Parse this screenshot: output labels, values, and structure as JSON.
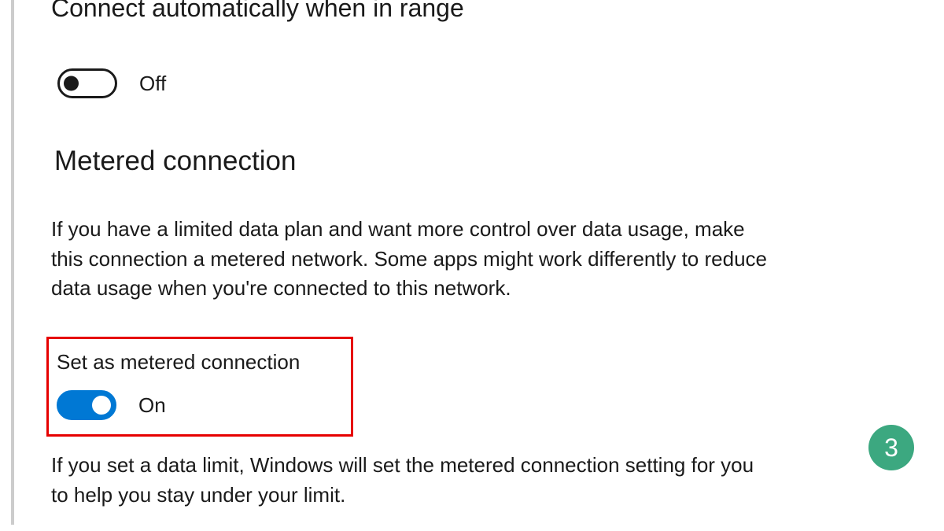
{
  "autoConnect": {
    "heading": "Connect automatically when in range",
    "state": "off",
    "label": "Off"
  },
  "metered": {
    "heading": "Metered connection",
    "description": "If you have a limited data plan and want more control over data usage, make this connection a metered network. Some apps might work differently to reduce data usage when you're connected to this network.",
    "setLabel": "Set as metered connection",
    "state": "on",
    "stateLabel": "On",
    "footnote": "If you set a data limit, Windows will set the metered connection setting for you to help you stay under your limit."
  },
  "badge": "3",
  "colors": {
    "accent": "#0078d4",
    "highlight": "#e60000",
    "badge": "#3ca880"
  }
}
